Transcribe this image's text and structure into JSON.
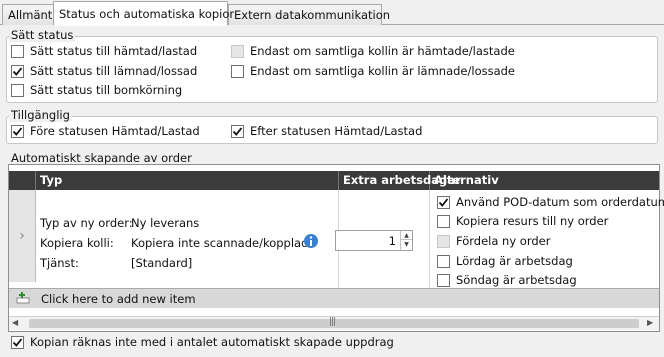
{
  "tabs": [
    {
      "label": "Allmänt"
    },
    {
      "label": "Status och automatiska kopior"
    },
    {
      "label": "Extern datakommunikation"
    }
  ],
  "satt_status": {
    "title": "Sätt status",
    "items": [
      {
        "label": "Sätt status till hämtad/lastad",
        "checked": false
      },
      {
        "label": "Sätt status till lämnad/lossad",
        "checked": true
      },
      {
        "label": "Sätt status till bomkörning",
        "checked": false
      },
      {
        "label": "Endast om samtliga kollin är hämtade/lastade",
        "checked": false
      },
      {
        "label": "Endast om samtliga kollin är lämnade/lossade",
        "checked": false
      }
    ]
  },
  "tillganglig": {
    "title": "Tillgänglig",
    "items": [
      {
        "label": "Före statusen Hämtad/Lastad",
        "checked": true
      },
      {
        "label": "Efter statusen Hämtad/Lastad",
        "checked": true
      }
    ]
  },
  "auto_order": {
    "title": "Automatiskt skapande av order",
    "columns": [
      "Typ",
      "Extra arbetsdagar",
      "Alternativ"
    ],
    "row": {
      "typ_label": "Typ av ny order:",
      "typ_value": "Ny leverans",
      "kolli_label": "Kopiera kolli:",
      "kolli_value": "Kopiera inte scannade/kopplade",
      "tjanst_label": "Tjänst:",
      "tjanst_value": "[Standard]",
      "extra_days": "1",
      "alternativ": [
        {
          "label": "Använd POD-datum som orderdatum",
          "checked": true
        },
        {
          "label": "Kopiera resurs till ny order",
          "checked": false
        },
        {
          "label": "Fördela ny order",
          "checked": false
        },
        {
          "label": "Lördag är arbetsdag",
          "checked": false
        },
        {
          "label": "Söndag är arbetsdag",
          "checked": false
        }
      ]
    },
    "new_item_text": "Click here to add new item"
  },
  "footer_checkbox": {
    "label": "Kopian räknas inte med i antalet automatiskt skapade uppdrag",
    "checked": true
  }
}
